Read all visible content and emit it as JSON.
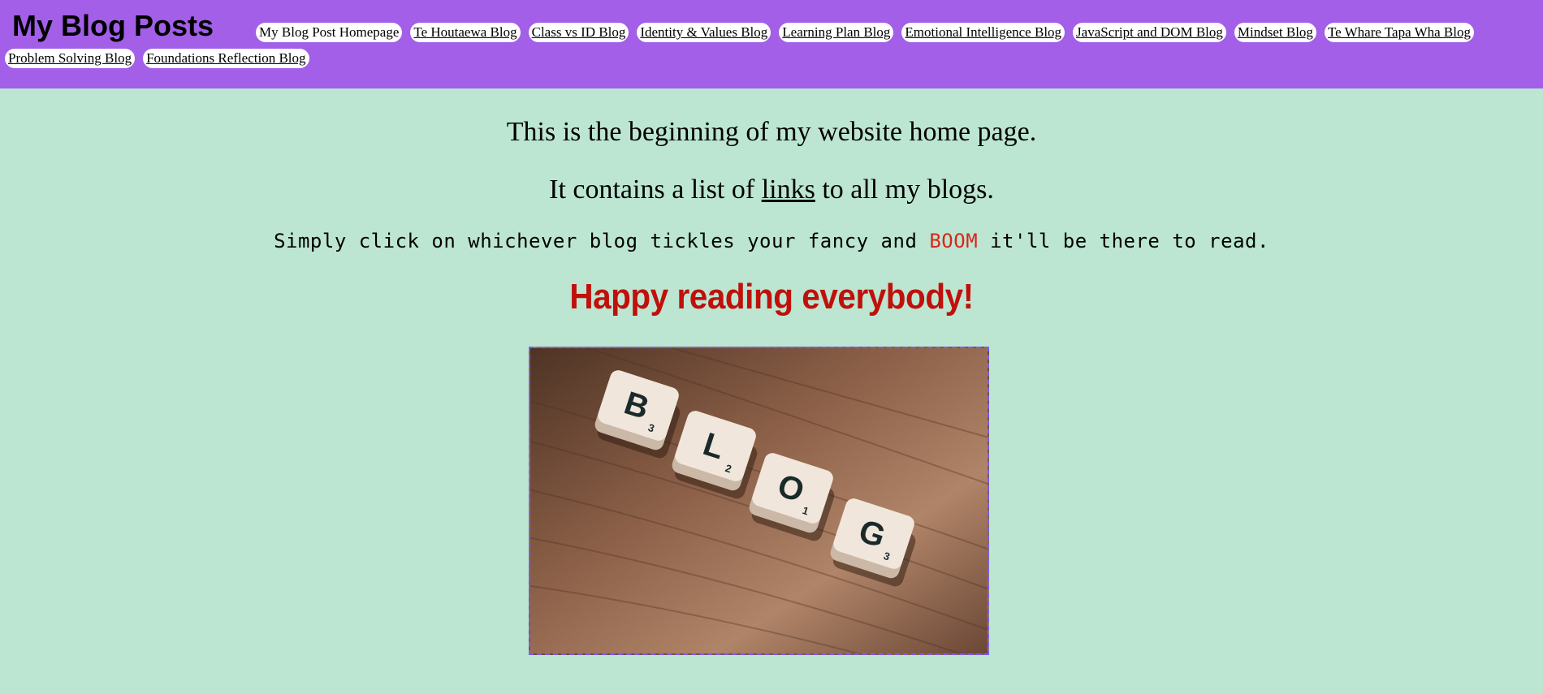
{
  "header": {
    "title": "My Blog Posts",
    "nav": [
      "My Blog Post Homepage",
      "Te Houtaewa Blog",
      "Class vs ID Blog",
      "Identity & Values Blog",
      "Learning Plan Blog",
      "Emotional Intelligence Blog",
      "JavaScript and DOM Blog",
      "Mindset Blog",
      "Te Whare Tapa Wha Blog",
      "Problem Solving Blog",
      "Foundations Reflection Blog"
    ]
  },
  "main": {
    "line1": "This is the beginning of my website home page.",
    "line2_before": "It contains a list of ",
    "line2_link": "links",
    "line2_after": " to all my blogs.",
    "line3_before": "Simply click on whichever blog tickles your fancy and ",
    "line3_boom": "BOOM",
    "line3_after": " it'll be there to read.",
    "happy": "Happy reading everybody!",
    "image": {
      "tiles": [
        {
          "letter": "B",
          "sub": "3"
        },
        {
          "letter": "L",
          "sub": "2"
        },
        {
          "letter": "O",
          "sub": "1"
        },
        {
          "letter": "G",
          "sub": "3"
        }
      ]
    }
  }
}
